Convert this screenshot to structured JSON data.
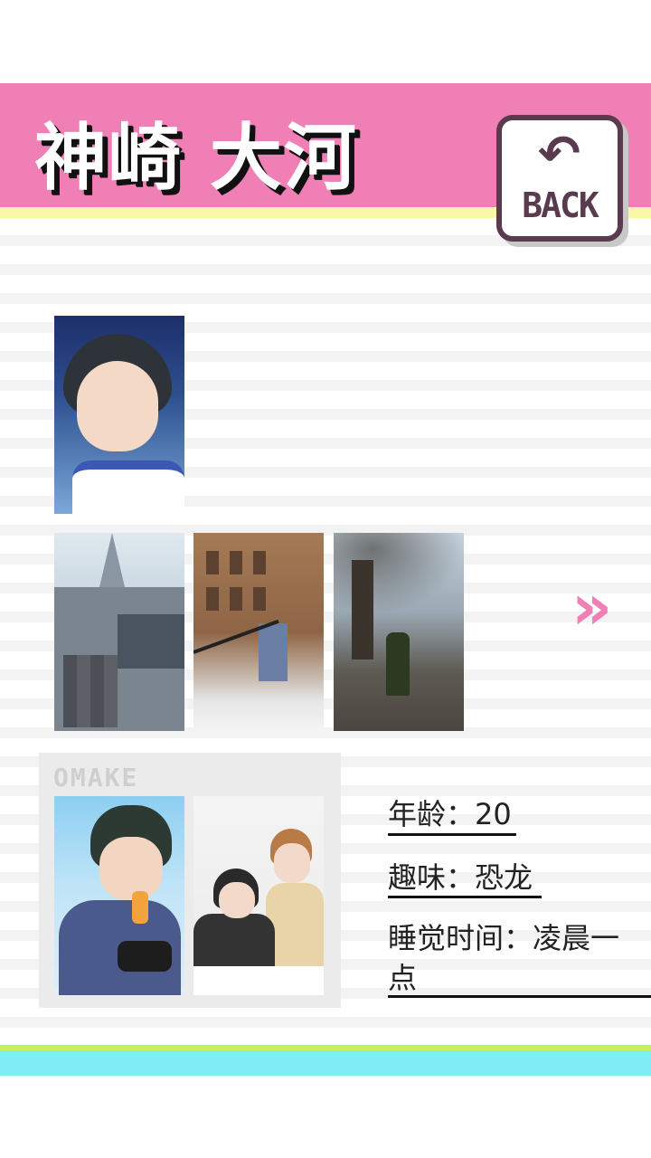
{
  "header": {
    "title": "神崎 大河",
    "back_button": {
      "label": "BACK",
      "icon": "undo-arrow-icon"
    }
  },
  "gallery": {
    "portrait": {
      "name": "character-portrait",
      "alt": ""
    },
    "photos": [
      {
        "name": "church-photo"
      },
      {
        "name": "building-photo"
      },
      {
        "name": "tree-photo"
      }
    ],
    "next_icon": "»"
  },
  "omake": {
    "label": "OMAKE",
    "images": [
      {
        "name": "omake-image-1"
      },
      {
        "name": "omake-image-2"
      }
    ]
  },
  "profile": {
    "age": {
      "key": "年龄：",
      "value": "20"
    },
    "hobby": {
      "key": "趣味：",
      "value": "恐龙"
    },
    "sleep": {
      "key": "睡觉时间：",
      "value": "凌晨一点"
    }
  },
  "colors": {
    "header_pink": "#f07fb6",
    "header_yellow": "#fbf9a8",
    "back_border": "#5a3a4e",
    "footer_green": "#c8ef5c",
    "footer_cyan": "#7eeef4"
  }
}
